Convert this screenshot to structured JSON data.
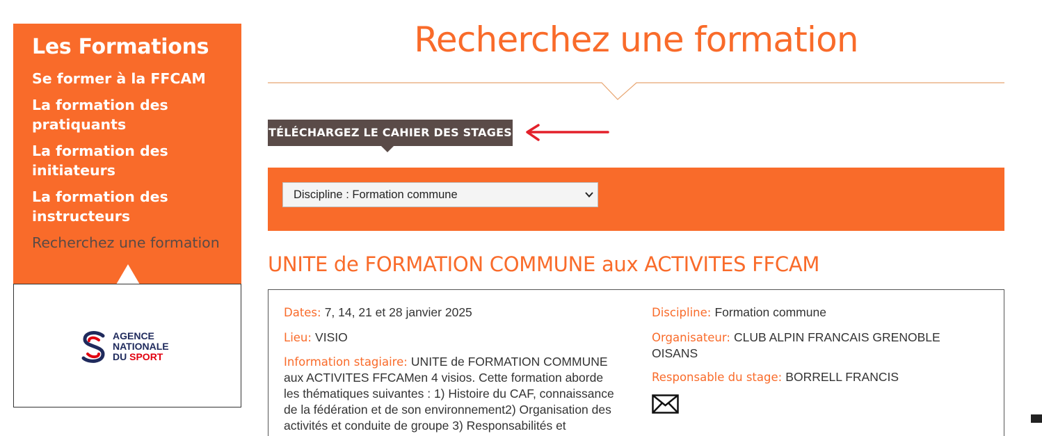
{
  "sidebar": {
    "title": "Les Formations",
    "items": [
      {
        "label": "Se former à la FFCAM"
      },
      {
        "label": "La formation des pratiquants"
      },
      {
        "label": "La formation des initiateurs"
      },
      {
        "label": "La formation des instructeurs"
      },
      {
        "label": "Recherchez une formation"
      }
    ]
  },
  "logo": {
    "line1": "AGENCE",
    "line2": "NATIONALE",
    "line3_prefix": "DU ",
    "line3_red": "SPORT"
  },
  "main": {
    "title": "Recherchez une formation",
    "download_button": "TÉLÉCHARGEZ LE CAHIER DES STAGES",
    "filter": {
      "selected": "Discipline : Formation commune"
    },
    "course": {
      "title": "UNITE de FORMATION COMMUNE aux ACTIVITES FFCAM",
      "dates_label": "Dates:",
      "dates_value": "7, 14, 21 et 28 janvier 2025",
      "lieu_label": "Lieu:",
      "lieu_value": "VISIO",
      "info_label": "Information stagiaire:",
      "info_line1": "UNITE de FORMATION COMMUNE",
      "info_line2": "aux ACTIVITES FFCAMen 4 visios. Cette formation aborde",
      "info_line3": "les thématiques suivantes : 1) Histoire du CAF, connaissance",
      "info_line4": "de la fédération et de son environnement2) Organisation des",
      "info_line5": "activités et conduite de groupe 3) Responsabilités et",
      "discipline_label": "Discipline:",
      "discipline_value": "Formation commune",
      "organisateur_label": "Organisateur:",
      "organisateur_line1": "CLUB ALPIN FRANCAIS GRENOBLE",
      "organisateur_line2": "OISANS",
      "responsable_label": "Responsable du stage:",
      "responsable_value": "BORRELL FRANCIS",
      "contact_icon": "envelope-icon"
    }
  },
  "colors": {
    "brand_orange": "#f96b2a",
    "dark_button": "#5a4b48",
    "arrow_red": "#e3202a"
  }
}
